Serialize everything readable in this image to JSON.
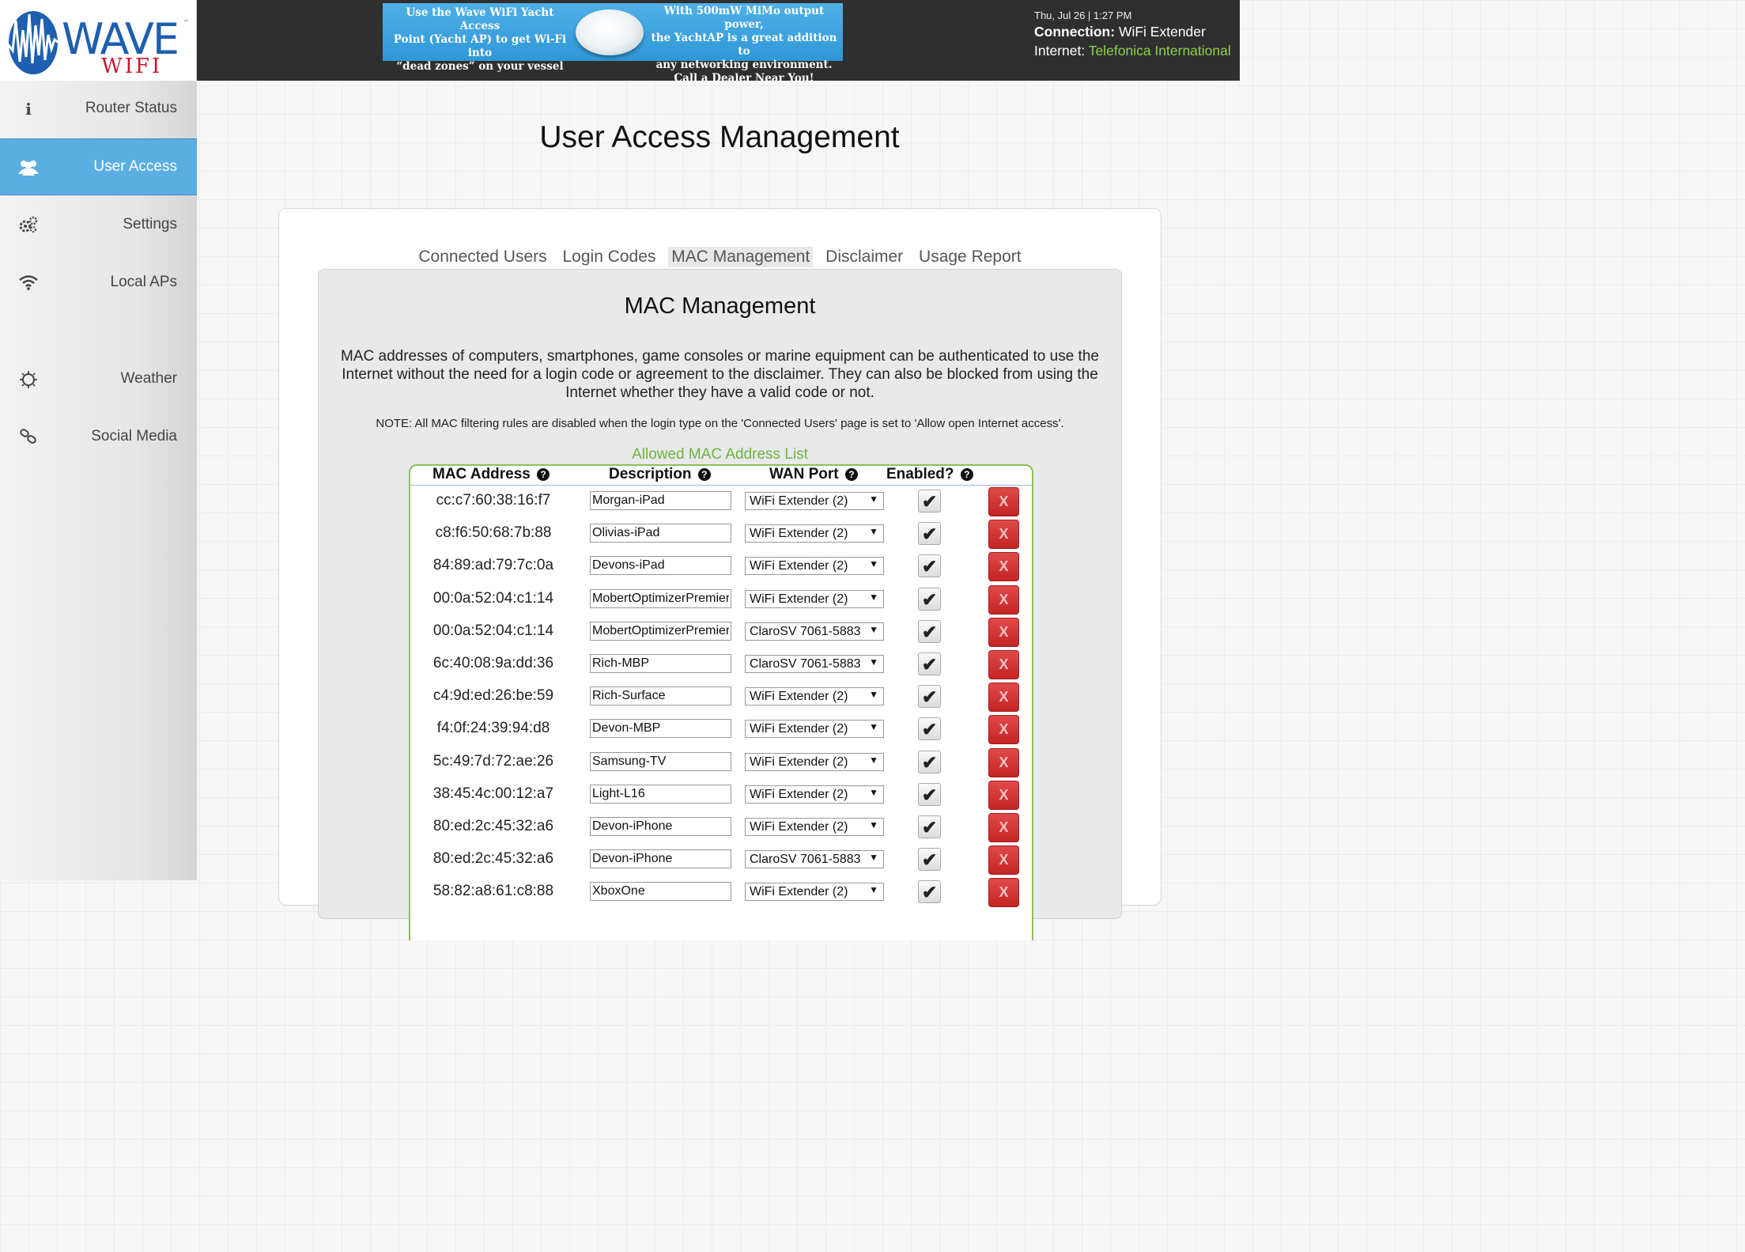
{
  "brand": {
    "logo_text": "WAVE",
    "logo_sub": "WIFI",
    "logo_tm": "™"
  },
  "ad": {
    "left_text": "Use the Wave WiFi Yacht Access\nPoint (Yacht AP) to get Wi-Fi into\n“dead zones” on your vessel",
    "right_text": "With 500mW MiMo output power,\nthe YachtAP is a great addition to\nany networking environment.\nCall a Dealer Near You!"
  },
  "status": {
    "datetime": "Thu, Jul 26 | 1:27 PM",
    "connection_label": "Connection:",
    "connection_value": "WiFi Extender",
    "internet_label": "Internet:",
    "internet_value": "Telefonica International"
  },
  "sidebar": {
    "items": [
      {
        "label": "Router Status",
        "icon": "info-icon"
      },
      {
        "label": "User Access",
        "icon": "users-icon",
        "active": true
      },
      {
        "label": "Settings",
        "icon": "gears-icon"
      },
      {
        "label": "Local APs",
        "icon": "wifi-icon"
      },
      {
        "label": "Weather",
        "icon": "sun-icon"
      },
      {
        "label": "Social Media",
        "icon": "link-icon"
      }
    ]
  },
  "page": {
    "title": "User Access Management"
  },
  "tabs": [
    "Connected Users",
    "Login Codes",
    "MAC Management",
    "Disclaimer",
    "Usage Report"
  ],
  "section": {
    "title": "MAC Management",
    "description": "MAC addresses of computers, smartphones, game consoles or marine equipment can be authenticated to use the Internet without the need for a login code or agreement to the disclaimer. They can also be blocked from using the Internet whether they have a valid code or not.",
    "note": "NOTE: All MAC filtering rules are disabled when the login type on the 'Connected Users' page is set to 'Allow open Internet access'.",
    "list_title": "Allowed MAC Address List",
    "columns": {
      "mac": "MAC Address",
      "description": "Description",
      "wan": "WAN Port",
      "enabled": "Enabled?"
    },
    "help_glyph": "?",
    "check_glyph": "✔",
    "delete_glyph": "X",
    "select_arrow": "▼"
  },
  "rows": [
    {
      "mac": "cc:c7:60:38:16:f7",
      "description": "Morgan-iPad",
      "wan": "WiFi Extender (2)",
      "enabled": true
    },
    {
      "mac": "c8:f6:50:68:7b:88",
      "description": "Olivias-iPad",
      "wan": "WiFi Extender (2)",
      "enabled": true
    },
    {
      "mac": "84:89:ad:79:7c:0a",
      "description": "Devons-iPad",
      "wan": "WiFi Extender (2)",
      "enabled": true
    },
    {
      "mac": "00:0a:52:04:c1:14",
      "description": "MobertOptimizerPremier",
      "wan": "WiFi Extender (2)",
      "enabled": true
    },
    {
      "mac": "00:0a:52:04:c1:14",
      "description": "MobertOptimizerPremier",
      "wan": "ClaroSV 7061-5883",
      "enabled": true
    },
    {
      "mac": "6c:40:08:9a:dd:36",
      "description": "Rich-MBP",
      "wan": "ClaroSV 7061-5883",
      "enabled": true
    },
    {
      "mac": "c4:9d:ed:26:be:59",
      "description": "Rich-Surface",
      "wan": "WiFi Extender (2)",
      "enabled": true
    },
    {
      "mac": "f4:0f:24:39:94:d8",
      "description": "Devon-MBP",
      "wan": "WiFi Extender (2)",
      "enabled": true
    },
    {
      "mac": "5c:49:7d:72:ae:26",
      "description": "Samsung-TV",
      "wan": "WiFi Extender (2)",
      "enabled": true
    },
    {
      "mac": "38:45:4c:00:12:a7",
      "description": "Light-L16",
      "wan": "WiFi Extender (2)",
      "enabled": true
    },
    {
      "mac": "80:ed:2c:45:32:a6",
      "description": "Devon-iPhone",
      "wan": "WiFi Extender (2)",
      "enabled": true
    },
    {
      "mac": "80:ed:2c:45:32:a6",
      "description": "Devon-iPhone",
      "wan": "ClaroSV 7061-5883",
      "enabled": true
    },
    {
      "mac": "58:82:a8:61:c8:88",
      "description": "XboxOne",
      "wan": "WiFi Extender (2)",
      "enabled": true
    }
  ],
  "colors": {
    "header_bg": "#2f2f2f",
    "accent_blue": "#5aaee2",
    "accent_green": "#6db33f",
    "internet_green": "#8cd04a",
    "delete_red": "#d23535"
  }
}
